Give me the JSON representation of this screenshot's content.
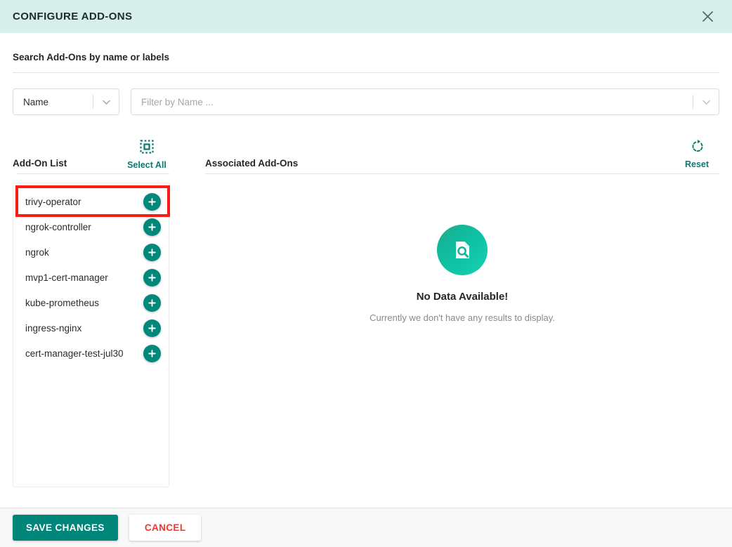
{
  "header": {
    "title": "CONFIGURE ADD-ONS",
    "close_icon": "close-icon"
  },
  "search": {
    "label": "Search Add-Ons by name or labels",
    "criteria_value": "Name",
    "criteria_chevron": "chevron-down-icon",
    "filter_placeholder": "Filter by Name ...",
    "filter_value": "",
    "filter_chevron": "chevron-down-icon"
  },
  "addon_list": {
    "title": "Add-On List",
    "select_all_label": "Select All",
    "select_all_icon": "select-all-icon",
    "items": [
      {
        "name": "trivy-operator",
        "action_icon": "plus-icon",
        "highlighted": true
      },
      {
        "name": "ngrok-controller",
        "action_icon": "plus-icon",
        "highlighted": false
      },
      {
        "name": "ngrok",
        "action_icon": "plus-icon",
        "highlighted": false
      },
      {
        "name": "mvp1-cert-manager",
        "action_icon": "plus-icon",
        "highlighted": false
      },
      {
        "name": "kube-prometheus",
        "action_icon": "plus-icon",
        "highlighted": false
      },
      {
        "name": "ingress-nginx",
        "action_icon": "plus-icon",
        "highlighted": false
      },
      {
        "name": "cert-manager-test-jul30",
        "action_icon": "plus-icon",
        "highlighted": false
      }
    ]
  },
  "associated": {
    "title": "Associated Add-Ons",
    "reset_label": "Reset",
    "reset_icon": "refresh-icon",
    "empty_icon": "document-search-icon",
    "empty_title": "No Data Available!",
    "empty_subtitle": "Currently we don't have any results to display."
  },
  "footer": {
    "save_label": "SAVE CHANGES",
    "cancel_label": "CANCEL"
  },
  "colors": {
    "header_bg": "#d7efeb",
    "teal": "#00897b",
    "teal_dark": "#0b7a6e",
    "save_bg": "#00857a",
    "cancel_text": "#fa352c",
    "highlight": "#fa1c12"
  }
}
